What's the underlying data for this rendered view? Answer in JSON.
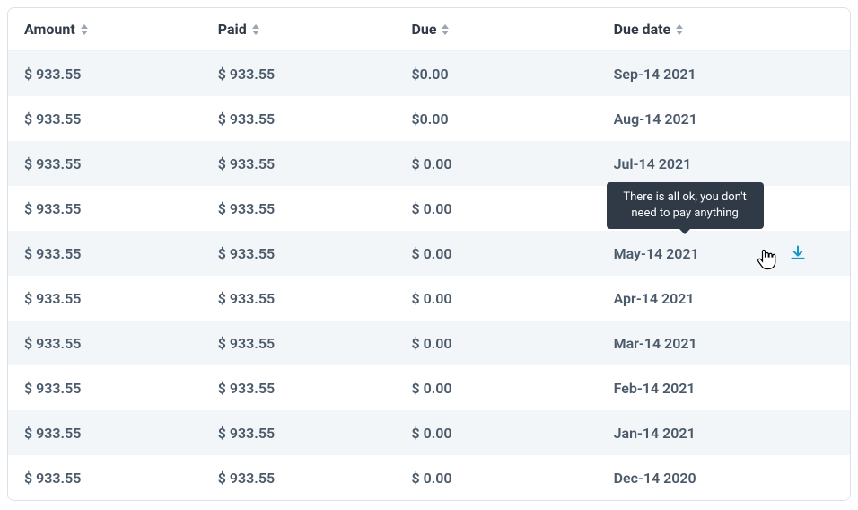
{
  "tooltip": "There is all ok, you don't need to pay anything",
  "headers": {
    "amount": "Amount",
    "paid": "Paid",
    "due": "Due",
    "due_date": "Due date"
  },
  "rows": [
    {
      "amount": "$ 933.55",
      "paid": "$ 933.55",
      "due": "$0.00",
      "due_date": "Sep-14 2021"
    },
    {
      "amount": "$ 933.55",
      "paid": "$ 933.55",
      "due": "$0.00",
      "due_date": "Aug-14 2021"
    },
    {
      "amount": "$ 933.55",
      "paid": "$ 933.55",
      "due": "$ 0.00",
      "due_date": "Jul-14 2021"
    },
    {
      "amount": "$ 933.55",
      "paid": "$ 933.55",
      "due": "$ 0.00",
      "due_date": ""
    },
    {
      "amount": "$ 933.55",
      "paid": "$ 933.55",
      "due": "$ 0.00",
      "due_date": "May-14 2021",
      "show_download": true,
      "show_cursor": true
    },
    {
      "amount": "$ 933.55",
      "paid": "$ 933.55",
      "due": "$ 0.00",
      "due_date": "Apr-14 2021"
    },
    {
      "amount": "$ 933.55",
      "paid": "$ 933.55",
      "due": "$ 0.00",
      "due_date": "Mar-14 2021"
    },
    {
      "amount": "$ 933.55",
      "paid": "$ 933.55",
      "due": "$ 0.00",
      "due_date": "Feb-14 2021"
    },
    {
      "amount": "$ 933.55",
      "paid": "$ 933.55",
      "due": "$ 0.00",
      "due_date": "Jan-14 2021"
    },
    {
      "amount": "$ 933.55",
      "paid": "$ 933.55",
      "due": "$ 0.00",
      "due_date": "Dec-14 2020"
    }
  ]
}
